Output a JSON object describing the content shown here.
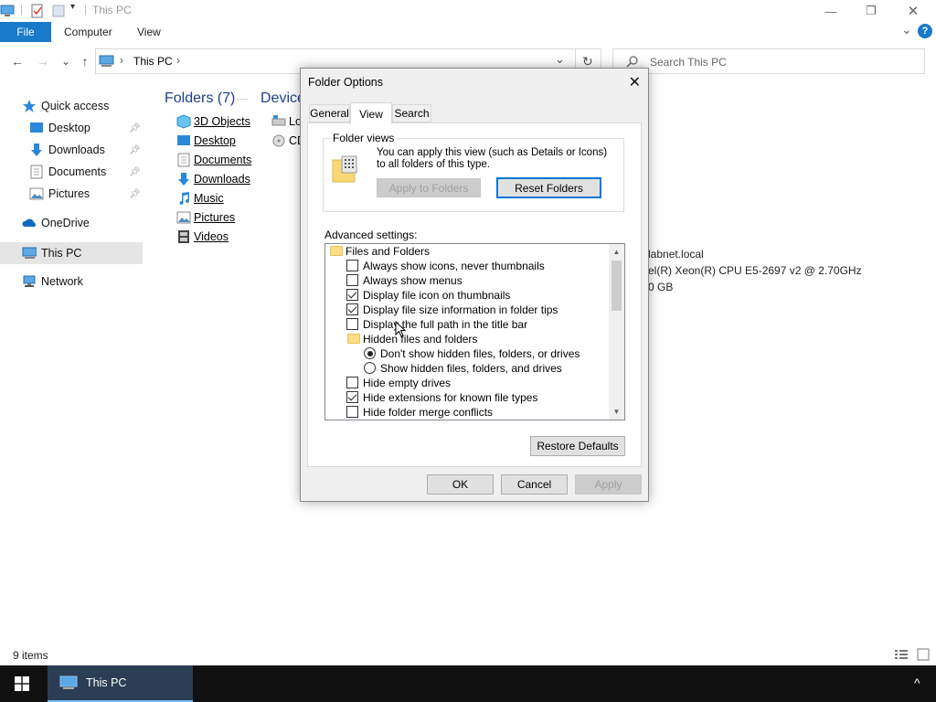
{
  "window": {
    "title": "This PC",
    "minimize": "—",
    "maximize": "❐",
    "close": "✕"
  },
  "ribbon": {
    "file": "File",
    "tabs": [
      "Computer",
      "View"
    ],
    "expand": "⌄",
    "help": "?"
  },
  "address": {
    "back": "←",
    "forward": "→",
    "recent": "⌄",
    "up": "↑",
    "sep1": "›",
    "path": "This PC",
    "sep2": "›",
    "dropdown": "⌄",
    "refresh": "↻",
    "search_placeholder": "Search This PC"
  },
  "navpane": {
    "items": [
      {
        "label": "Quick access"
      },
      {
        "label": "Desktop"
      },
      {
        "label": "Downloads"
      },
      {
        "label": "Documents"
      },
      {
        "label": "Pictures"
      },
      {
        "label": "OneDrive"
      },
      {
        "label": "This PC"
      },
      {
        "label": "Network"
      }
    ]
  },
  "content": {
    "folders_header": "Folders (7)",
    "devices_header": "Device",
    "folders": [
      "3D Objects",
      "Desktop",
      "Documents",
      "Downloads",
      "Music",
      "Pictures",
      "Videos"
    ],
    "devices": [
      "Lo",
      "CD"
    ],
    "details": [
      "labnet.local",
      "el(R) Xeon(R) CPU E5-2697 v2 @ 2.70GHz",
      "0 GB"
    ]
  },
  "status": {
    "items": "9 items"
  },
  "taskbar": {
    "app_label": "This PC",
    "tray_arrow": "^"
  },
  "dialog": {
    "title": "Folder Options",
    "close": "✕",
    "tabs": [
      "General",
      "View",
      "Search"
    ],
    "active_tab": "View",
    "folder_views": {
      "legend": "Folder views",
      "description": "You can apply this view (such as Details or Icons) to all folders of this type.",
      "apply_button": "Apply to Folders",
      "reset_button": "Reset Folders"
    },
    "advanced_label": "Advanced settings:",
    "tree": {
      "root": "Files and Folders",
      "items": [
        {
          "label": "Always show icons, never thumbnails",
          "checked": false
        },
        {
          "label": "Always show menus",
          "checked": false
        },
        {
          "label": "Display file icon on thumbnails",
          "checked": true
        },
        {
          "label": "Display file size information in folder tips",
          "checked": true
        },
        {
          "label": "Display the full path in the title bar",
          "checked": false
        }
      ],
      "hidden_group": "Hidden files and folders",
      "radios": [
        {
          "label": "Don't show hidden files, folders, or drives",
          "checked": true
        },
        {
          "label": "Show hidden files, folders, and drives",
          "checked": false
        }
      ],
      "more_items": [
        {
          "label": "Hide empty drives",
          "checked": false
        },
        {
          "label": "Hide extensions for known file types",
          "checked": true
        },
        {
          "label": "Hide folder merge conflicts",
          "checked": false
        }
      ]
    },
    "restore_button": "Restore Defaults",
    "ok_button": "OK",
    "cancel_button": "Cancel",
    "apply_button": "Apply"
  }
}
